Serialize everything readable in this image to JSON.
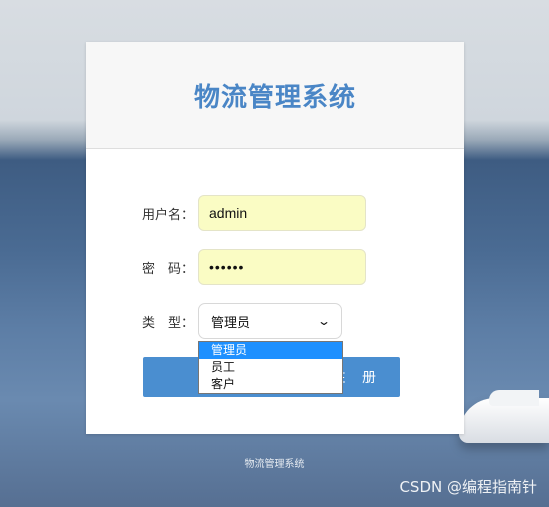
{
  "app_title": "物流管理系统",
  "form": {
    "username_label": "用户名：",
    "username_value": "admin",
    "password_label": "密　码：",
    "password_value": "••••••",
    "type_label": "类　型：",
    "type_selected": "管理员",
    "type_options": [
      "管理员",
      "员工",
      "客户"
    ],
    "register_label": "注 册"
  },
  "footer_text": "物流管理系统",
  "watermark": "CSDN @编程指南针",
  "colors": {
    "title": "#4a86c6",
    "button": "#4a8ed0",
    "input_bg": "#fafcc4",
    "option_highlight": "#1e90ff"
  }
}
